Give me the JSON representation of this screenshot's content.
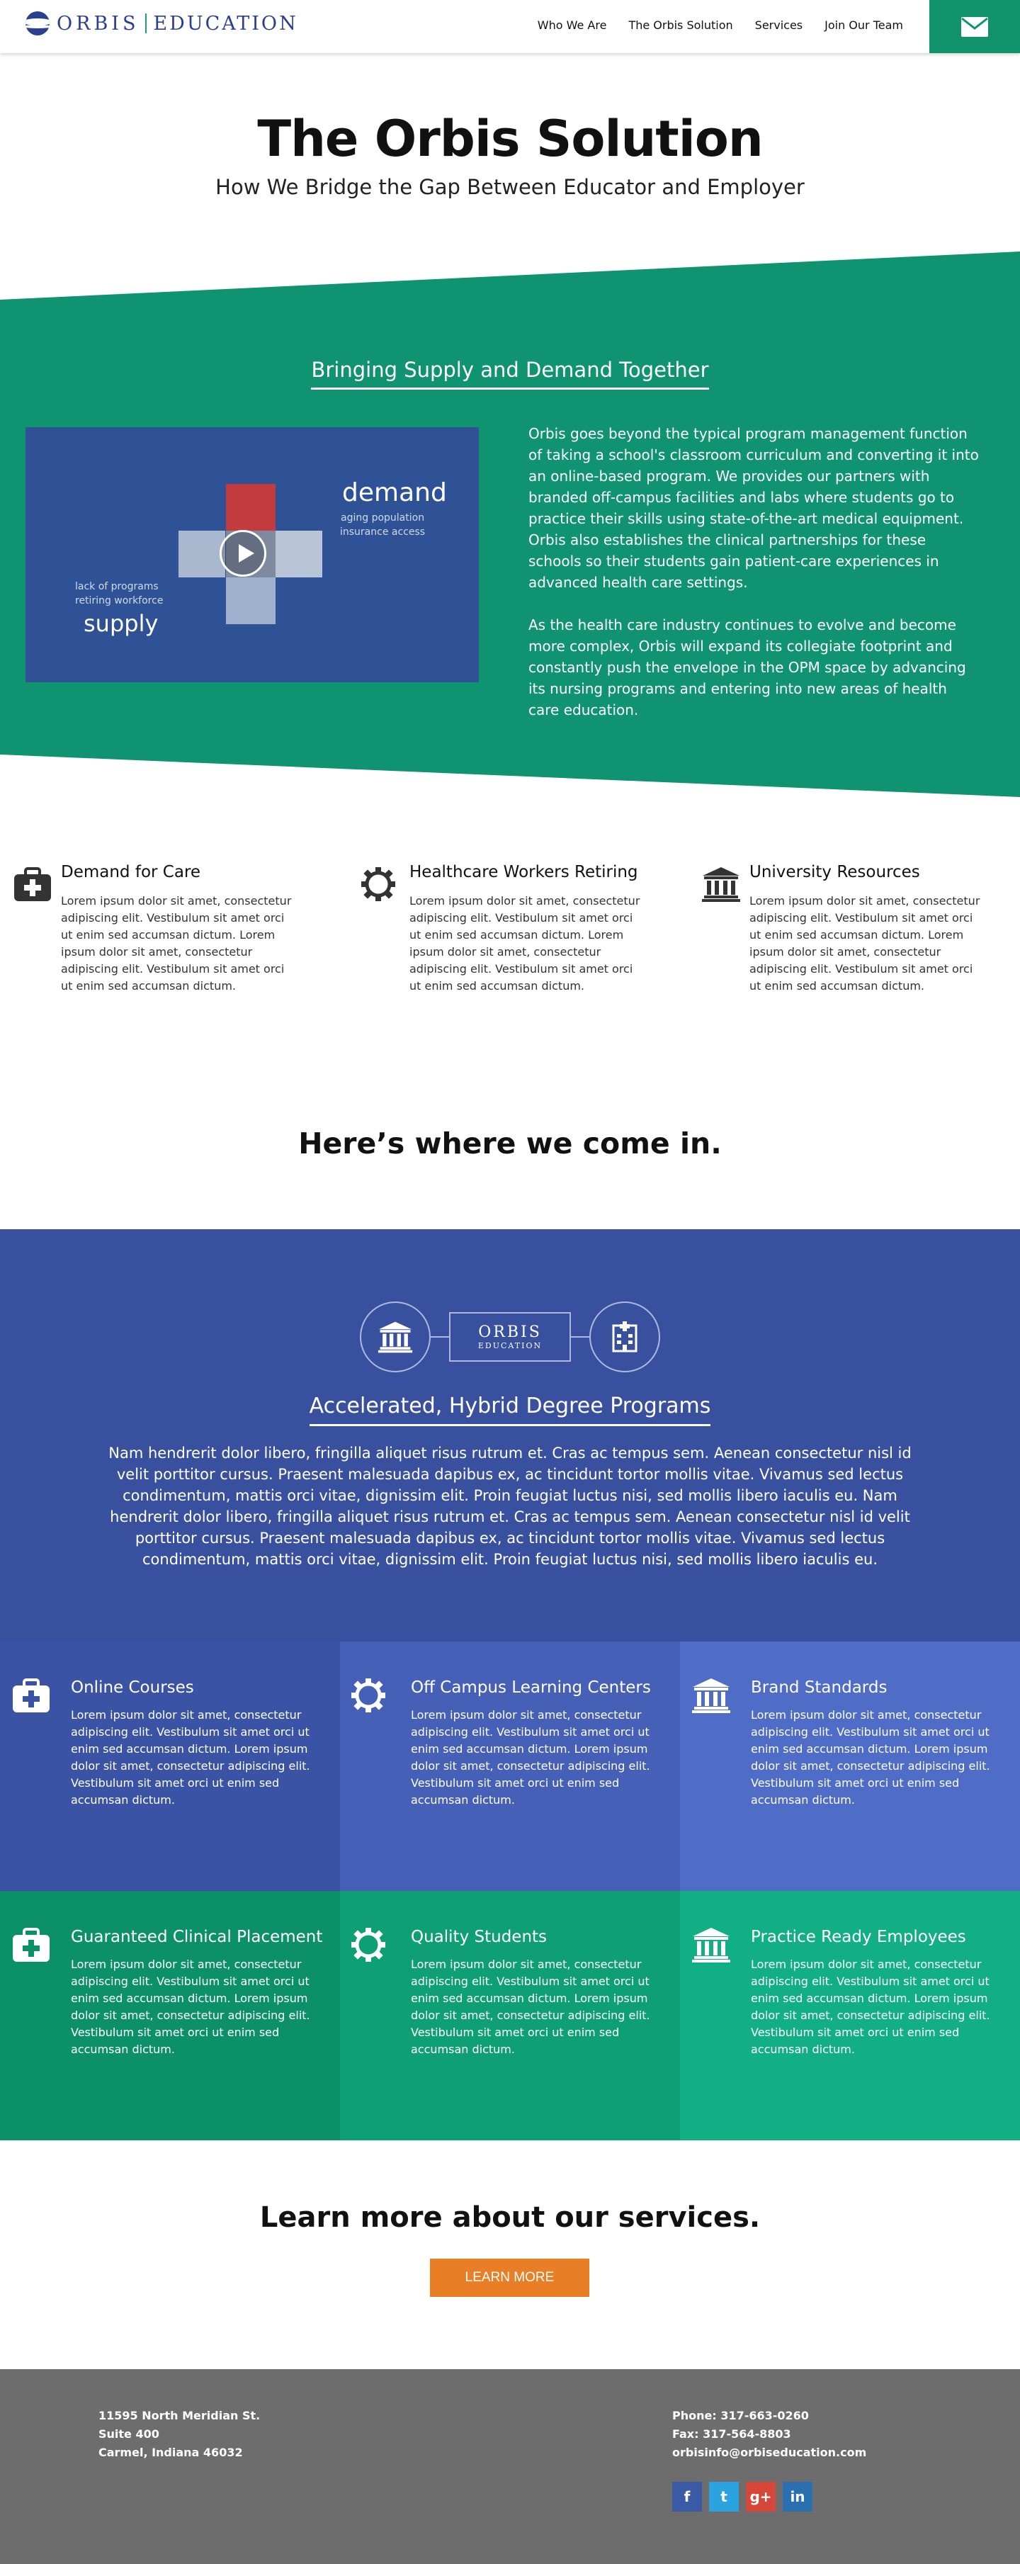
{
  "header": {
    "logo_left": "ORBIS",
    "logo_right": "EDUCATION",
    "nav": [
      "Who We Are",
      "The Orbis Solution",
      "Services",
      "Join Our Team"
    ],
    "mail_icon": "envelope-icon"
  },
  "hero": {
    "title": "The Orbis Solution",
    "subtitle": "How We Bridge the Gap Between Educator and Employer"
  },
  "supply_demand": {
    "title": "Bringing Supply and Demand Together",
    "video": {
      "demand": "demand",
      "demand_sub_1": "aging population",
      "demand_sub_2": "insurance access",
      "supply_sub_1": "lack of programs",
      "supply_sub_2": "retiring workforce",
      "supply": "supply"
    },
    "paragraphs": [
      "Orbis goes beyond the typical program management function of taking a school's classroom curriculum and converting it into an online-based program. We provides our partners with branded off-campus facilities and labs where students go to practice their skills using state-of-the-art medical equipment. Orbis also establishes the clinical partnerships for these schools so their students gain patient-care experiences in advanced health care settings.",
      "As the health care industry continues to evolve and become more complex, Orbis will expand its collegiate footprint and constantly push the envelope in the OPM space by advancing its nursing programs and entering into new areas of health care education."
    ]
  },
  "features": [
    {
      "icon": "medical-kit-icon",
      "title": "Demand for Care",
      "text": "Lorem ipsum dolor sit amet, consectetur adipiscing elit. Vestibulum sit amet orci ut enim sed accumsan dictum.  Lorem ipsum dolor sit amet, consectetur adipiscing elit. Vestibulum sit amet orci ut enim sed accumsan dictum."
    },
    {
      "icon": "gear-icon",
      "title": "Healthcare Workers Retiring",
      "text": "Lorem ipsum dolor sit amet, consectetur adipiscing elit. Vestibulum sit amet orci ut enim sed accumsan dictum.  Lorem ipsum dolor sit amet, consectetur adipiscing elit. Vestibulum sit amet orci ut enim sed accumsan dictum."
    },
    {
      "icon": "university-icon",
      "title": "University Resources",
      "text": "Lorem ipsum dolor sit amet, consectetur adipiscing elit. Vestibulum sit amet orci ut enim sed accumsan dictum.  Lorem ipsum dolor sit amet, consectetur adipiscing elit. Vestibulum sit amet orci ut enim sed accumsan dictum."
    }
  ],
  "come_in": "Here’s where we come in.",
  "accelerated": {
    "logo_top": "ORBIS",
    "logo_bottom": "EDUCATION",
    "title": "Accelerated, Hybrid Degree Programs",
    "text": "Nam hendrerit dolor libero, fringilla aliquet risus rutrum et. Cras ac tempus sem. Aenean consectetur nisl id velit porttitor cursus. Praesent malesuada dapibus ex, ac tincidunt tortor mollis vitae. Vivamus sed lectus condimentum, mattis orci vitae, dignissim elit. Proin feugiat luctus nisi, sed mollis libero iaculis eu.  Nam hendrerit dolor libero, fringilla aliquet risus rutrum et. Cras ac tempus sem. Aenean consectetur nisl id velit porttitor cursus. Praesent malesuada dapibus ex, ac tincidunt tortor mollis vitae. Vivamus sed lectus condimentum, mattis orci vitae, dignissim elit. Proin feugiat luctus nisi, sed mollis libero iaculis eu."
  },
  "tiles": [
    {
      "icon": "medical-kit-icon",
      "title": "Online Courses",
      "color": "#3a53a4",
      "text": "Lorem ipsum dolor sit amet, consectetur adipiscing elit. Vestibulum sit amet orci ut enim sed accumsan dictum.  Lorem ipsum dolor sit amet, consectetur adipiscing elit. Vestibulum sit amet orci ut enim sed accumsan dictum."
    },
    {
      "icon": "gear-icon",
      "title": "Off Campus Learning Centers",
      "color": "#4560b6",
      "text": "Lorem ipsum dolor sit amet, consectetur adipiscing elit. Vestibulum sit amet orci ut enim sed accumsan dictum.  Lorem ipsum dolor sit amet, consectetur adipiscing elit. Vestibulum sit amet orci ut enim sed accumsan dictum."
    },
    {
      "icon": "university-icon",
      "title": "Brand Standards",
      "color": "#4f6cc7",
      "text": "Lorem ipsum dolor sit amet, consectetur adipiscing elit. Vestibulum sit amet orci ut enim sed accumsan dictum.  Lorem ipsum dolor sit amet, consectetur adipiscing elit. Vestibulum sit amet orci ut enim sed accumsan dictum."
    },
    {
      "icon": "medical-kit-icon",
      "title": "Guaranteed Clinical Placement",
      "color": "#0b9068",
      "text": "Lorem ipsum dolor sit amet, consectetur adipiscing elit. Vestibulum sit amet orci ut enim sed accumsan dictum.  Lorem ipsum dolor sit amet, consectetur adipiscing elit. Vestibulum sit amet orci ut enim sed accumsan dictum."
    },
    {
      "icon": "gear-icon",
      "title": "Quality Students",
      "color": "#0f9f75",
      "text": "Lorem ipsum dolor sit amet, consectetur adipiscing elit. Vestibulum sit amet orci ut enim sed accumsan dictum.  Lorem ipsum dolor sit amet, consectetur adipiscing elit. Vestibulum sit amet orci ut enim sed accumsan dictum."
    },
    {
      "icon": "university-icon",
      "title": "Practice Ready Employees",
      "color": "#12ae84",
      "text": "Lorem ipsum dolor sit amet, consectetur adipiscing elit. Vestibulum sit amet orci ut enim sed accumsan dictum.  Lorem ipsum dolor sit amet, consectetur adipiscing elit. Vestibulum sit amet orci ut enim sed accumsan dictum."
    }
  ],
  "cta": {
    "title": "Learn more about our services.",
    "button": "LEARN MORE",
    "button_color": "#e87e25"
  },
  "footer": {
    "address": [
      "11595 North Meridian St.",
      "Suite 400",
      "Carmel, Indiana 46032"
    ],
    "phone": "Phone: 317-663-0260",
    "fax": "Fax: 317-564-8803",
    "email": "orbisinfo@orbiseducation.com",
    "social": [
      {
        "icon": "facebook-icon",
        "glyph": "f",
        "color": "#3b5ba6"
      },
      {
        "icon": "twitter-icon",
        "glyph": "t",
        "color": "#2aa3e0"
      },
      {
        "icon": "google-plus-icon",
        "glyph": "g+",
        "color": "#d6473a"
      },
      {
        "icon": "linkedin-icon",
        "glyph": "in",
        "color": "#2a6fb0"
      }
    ]
  }
}
